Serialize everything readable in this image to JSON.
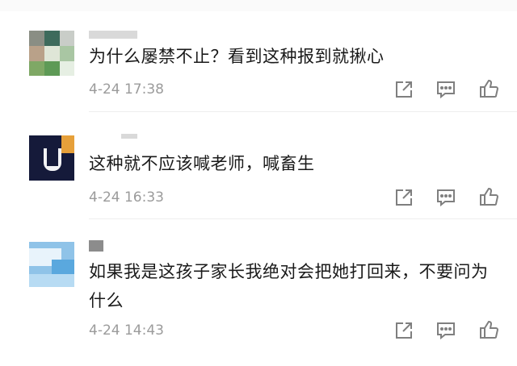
{
  "comments": [
    {
      "text": "为什么屡禁不止？看到这种报到就揪心",
      "time": "4-24 17:38"
    },
    {
      "text": "这种就不应该喊老师，喊畜生",
      "time": "4-24 16:33"
    },
    {
      "text": "如果我是这孩子家长我绝对会把她打回来，不要问为什么",
      "time": "4-24 14:43"
    }
  ],
  "icons": {
    "share": "share-icon",
    "reply": "comment-icon",
    "like": "thumbs-up-icon"
  },
  "colors": {
    "text": "#1a1a1a",
    "meta": "#9b9b9b",
    "icon": "#7f7f7f",
    "divider": "#eeeeee"
  }
}
